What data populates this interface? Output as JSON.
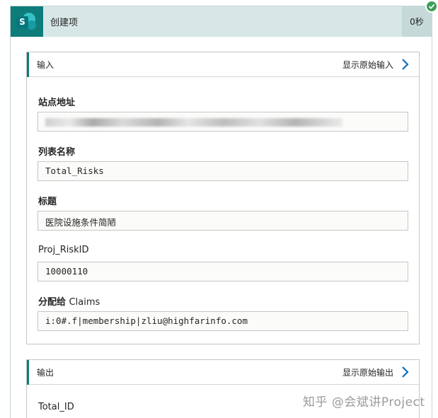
{
  "header": {
    "title": "创建项",
    "duration": "0秒",
    "app_icon": "sharepoint-icon",
    "status_icon": "check-icon",
    "status_color": "#3d9f5a",
    "accent_color": "#0f7c7c"
  },
  "inputs": {
    "label": "输入",
    "raw_link": "显示原始输入",
    "fields": [
      {
        "label": "站点地址",
        "value": ""
      },
      {
        "label": "列表名称",
        "value": "Total_Risks"
      },
      {
        "label": "标题",
        "value": "医院设施条件简陋"
      },
      {
        "label": "Proj_RiskID",
        "value": "10000110"
      },
      {
        "label_cn": "分配给",
        "label_en": "Claims",
        "value": "i:0#.f|membership|zliu@highfarinfo.com"
      }
    ]
  },
  "outputs": {
    "label": "输出",
    "raw_link": "显示原始输出",
    "fields": [
      {
        "label": "Total_ID"
      }
    ]
  },
  "watermark": "知乎 @会斌讲Project"
}
